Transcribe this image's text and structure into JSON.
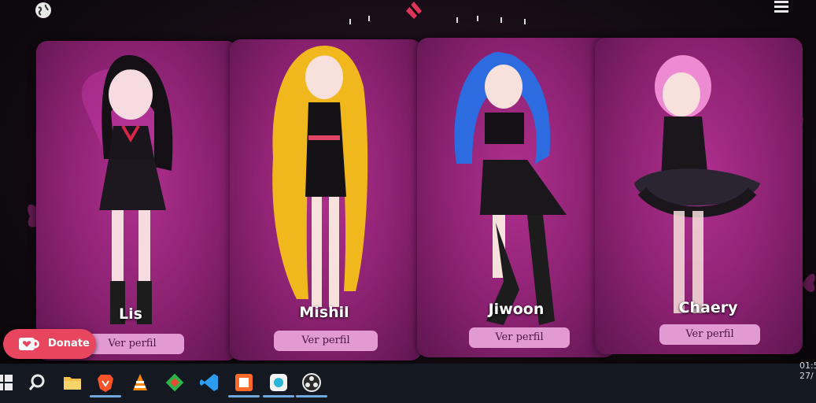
{
  "header": {
    "globe_icon": "globe-icon",
    "logo_icon": "brand-logo-icon",
    "menu_icon": "hamburger-menu-icon"
  },
  "characters": [
    {
      "name": "Lis",
      "button_label": "Ver perfil"
    },
    {
      "name": "Mishil",
      "button_label": "Ver perfil"
    },
    {
      "name": "Jiwoon",
      "button_label": "Ver perfil"
    },
    {
      "name": "Chaery",
      "button_label": "Ver perfil"
    }
  ],
  "donate": {
    "label": "Donate",
    "icon": "coffee-cup-heart-icon"
  },
  "taskbar": {
    "icons": [
      "windows-start-icon",
      "search-icon",
      "file-explorer-icon",
      "brave-browser-icon",
      "vlc-icon",
      "git-icon",
      "vscode-icon",
      "app-icon",
      "app-icon",
      "obs-icon"
    ]
  },
  "clock": {
    "time": "01:5",
    "date": "27/"
  },
  "colors": {
    "card": "#8a2170",
    "button": "#e29ad3",
    "donate": "#e8455f",
    "taskbar": "#141820"
  }
}
